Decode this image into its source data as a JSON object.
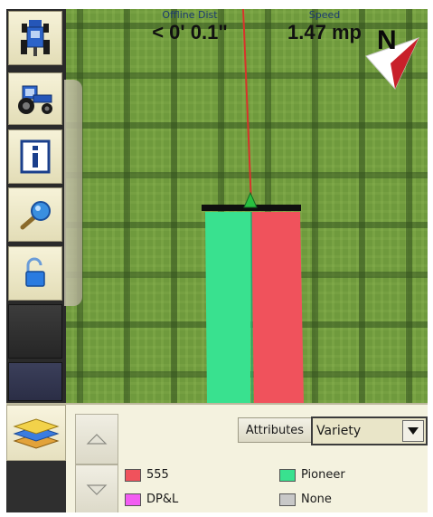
{
  "readouts": {
    "offline_dist": {
      "label": "Offline Dist",
      "value": "< 0' 0.1\""
    },
    "speed": {
      "label": "Speed",
      "value": "1.47 mp"
    }
  },
  "compass": {
    "label": "N",
    "colors": {
      "red": "#c8202a",
      "white": "#ffffff"
    }
  },
  "coverage": {
    "left_color": "#39e18f",
    "right_color": "#f0525c",
    "bar_color": "#0f0f0f",
    "guidance_line_color": "#d8332b",
    "marker_color": "#28c040"
  },
  "toolbar": {
    "buttons": [
      {
        "name": "vehicle-setup-button",
        "icon": "tractor-top-icon"
      },
      {
        "name": "tractor-button",
        "icon": "tractor-icon"
      },
      {
        "name": "info-button",
        "icon": "info-icon"
      },
      {
        "name": "zoom-button",
        "icon": "magnifier-icon"
      },
      {
        "name": "unlock-button",
        "icon": "unlock-icon"
      }
    ]
  },
  "bottom_panel": {
    "layers_icon": "layers-icon",
    "attributes_button": "Attributes",
    "attribute_select": {
      "value": "Variety"
    },
    "legend": [
      {
        "label": "555",
        "color": "#f0525c"
      },
      {
        "label": "Pioneer",
        "color": "#39e18f"
      },
      {
        "label": "DP&L",
        "color": "#f25cf2"
      },
      {
        "label": "None",
        "color": "#c8c8c8"
      }
    ]
  }
}
